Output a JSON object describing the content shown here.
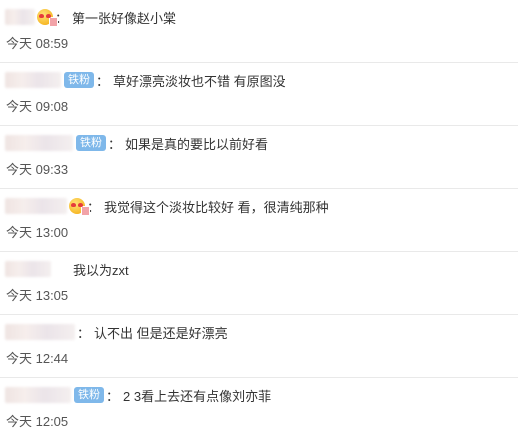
{
  "comments": [
    {
      "badge": "",
      "emoji": true,
      "text": "第一张好像赵小棠",
      "time": "今天 08:59"
    },
    {
      "badge": "铁粉",
      "emoji": false,
      "text": "草好漂亮淡妆也不错 有原图没",
      "time": "今天 09:08"
    },
    {
      "badge": "铁粉",
      "emoji": false,
      "text": "如果是真的要比以前好看",
      "time": "今天 09:33"
    },
    {
      "badge": "",
      "emoji": true,
      "text": "我觉得这个淡妆比较好 看，很清纯那种",
      "time": "今天 13:00"
    },
    {
      "badge": "",
      "emoji": false,
      "text": "我以为zxt",
      "time": "今天 13:05"
    },
    {
      "badge": "",
      "emoji": false,
      "text": "认不出 但是还是好漂亮",
      "time": "今天 12:44"
    },
    {
      "badge": "铁粉",
      "emoji": false,
      "text": "2 3看上去还有点像刘亦菲",
      "time": "今天 12:05"
    }
  ],
  "colon": "："
}
